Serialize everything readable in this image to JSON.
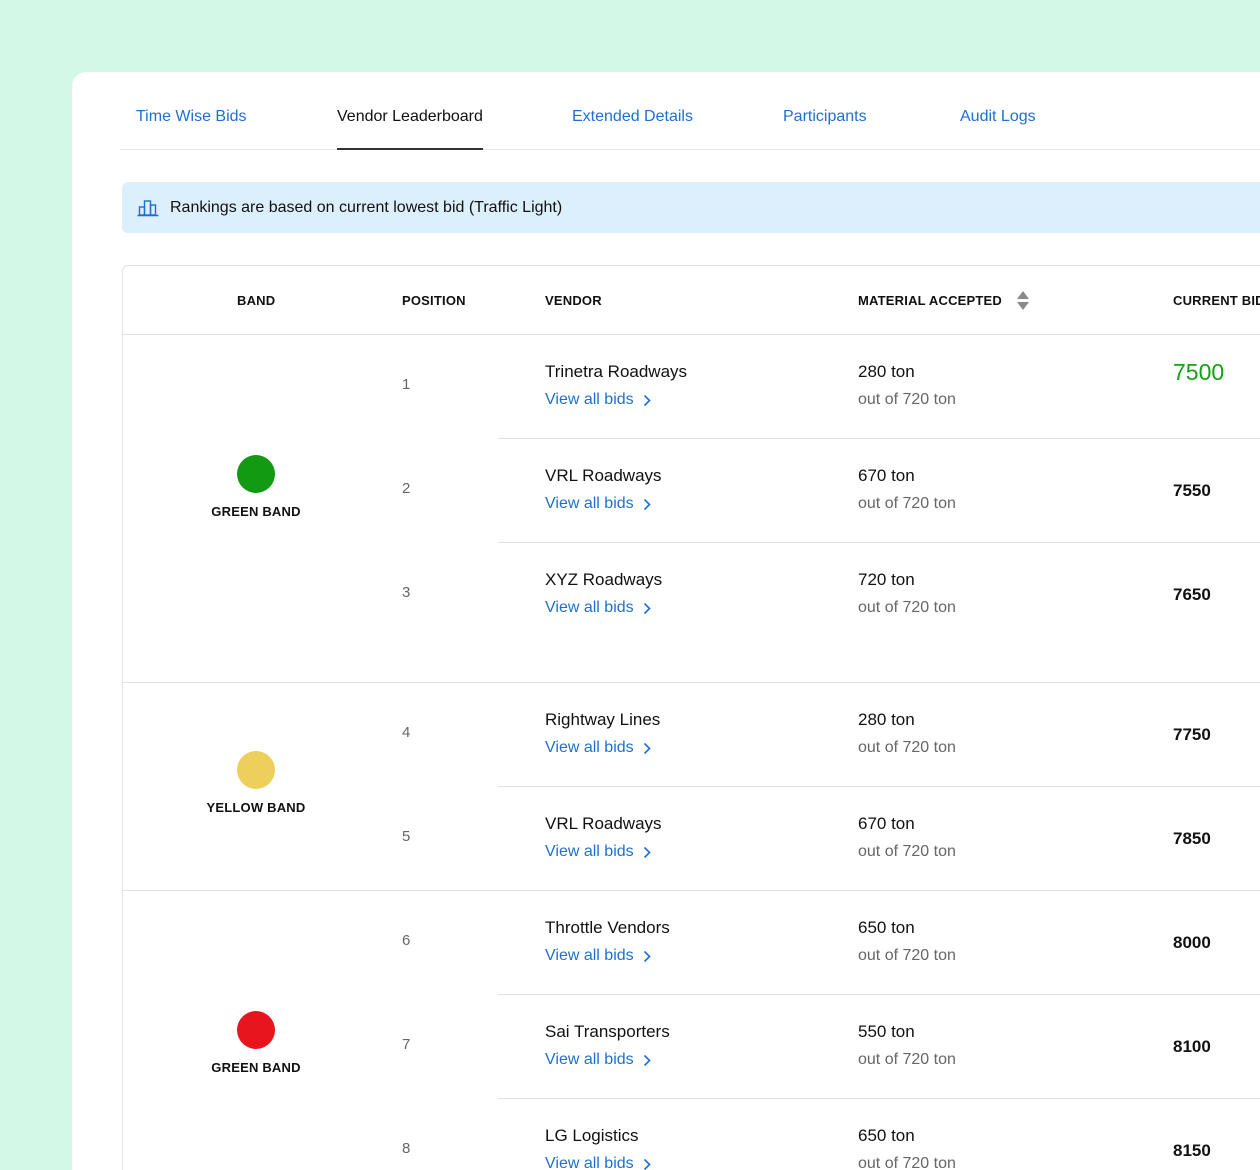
{
  "tabs": [
    {
      "label": "Time Wise Bids"
    },
    {
      "label": "Vendor Leaderboard"
    },
    {
      "label": "Extended Details"
    },
    {
      "label": "Participants"
    },
    {
      "label": "Audit Logs"
    }
  ],
  "active_tab": "Vendor Leaderboard",
  "banner": {
    "icon": "leaderboard-icon",
    "text": "Rankings are based on current lowest bid (Traffic Light)"
  },
  "table": {
    "columns": {
      "band": "BAND",
      "position": "POSITION",
      "vendor": "VENDOR",
      "material": "MATERIAL ACCEPTED",
      "current_bid": "CURRENT BID"
    },
    "groups": [
      {
        "band_label": "GREEN BAND",
        "color": "#139a13",
        "rows": [
          {
            "position": "1",
            "vendor": "Trinetra Roadways",
            "link": "View all bids",
            "material": "280 ton",
            "material_sub": "out of 720 ton",
            "bid": "7500"
          },
          {
            "position": "2",
            "vendor": "VRL Roadways",
            "link": "View all bids",
            "material": "670 ton",
            "material_sub": "out of 720 ton",
            "bid": "7550"
          },
          {
            "position": "3",
            "vendor": "XYZ Roadways",
            "link": "View all bids",
            "material": "720 ton",
            "material_sub": "out of 720 ton",
            "bid": "7650"
          }
        ]
      },
      {
        "band_label": "YELLOW BAND",
        "color": "#eecf5b",
        "rows": [
          {
            "position": "4",
            "vendor": "Rightway Lines",
            "link": "View all bids",
            "material": "280 ton",
            "material_sub": "out of 720 ton",
            "bid": "7750"
          },
          {
            "position": "5",
            "vendor": "VRL Roadways",
            "link": "View all bids",
            "material": "670 ton",
            "material_sub": "out of 720 ton",
            "bid": "7850"
          }
        ]
      },
      {
        "band_label": "GREEN BAND",
        "color": "#e8141e",
        "rows": [
          {
            "position": "6",
            "vendor": "Throttle Vendors",
            "link": "View all bids",
            "material": "650 ton",
            "material_sub": "out of 720 ton",
            "bid": "8000"
          },
          {
            "position": "7",
            "vendor": "Sai Transporters",
            "link": "View all bids",
            "material": "550 ton",
            "material_sub": "out of 720 ton",
            "bid": "8100"
          },
          {
            "position": "8",
            "vendor": "LG Logistics",
            "link": "View all bids",
            "material": "650 ton",
            "material_sub": "out of 720 ton",
            "bid": "8150"
          }
        ]
      }
    ]
  },
  "colors": {
    "background": "#d3f8e7",
    "link": "#1f6fd0",
    "best_bid": "#12a212",
    "banner": "#dbeffc"
  }
}
